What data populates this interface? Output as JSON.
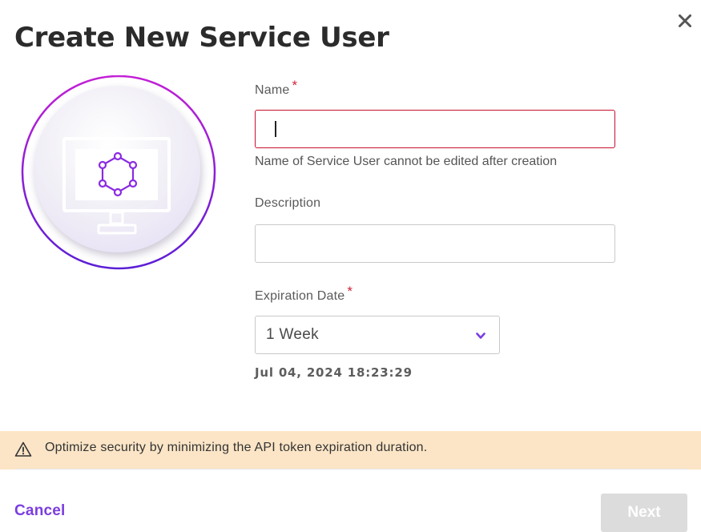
{
  "dialog": {
    "title": "Create New Service User",
    "close_icon": "close-icon"
  },
  "illustration": {
    "icon": "monitor-hexagon-network-icon",
    "ring_colors": [
      "#c21fd6",
      "#5b1fd6"
    ]
  },
  "form": {
    "name": {
      "label": "Name",
      "required_mark": "*",
      "value": "",
      "helper": "Name of Service User cannot be edited after creation",
      "state": "error"
    },
    "description": {
      "label": "Description",
      "value": ""
    },
    "expiration": {
      "label": "Expiration Date",
      "required_mark": "*",
      "selected": "1 Week",
      "date_readout": "Jul 04, 2024 18:23:29",
      "chevron_icon": "chevron-down-icon"
    }
  },
  "alert": {
    "icon": "warning-icon",
    "text": "Optimize security by minimizing the API token expiration duration."
  },
  "footer": {
    "cancel_label": "Cancel",
    "next_label": "Next",
    "next_enabled": false
  },
  "colors": {
    "accent": "#7b3ee0",
    "error": "#c8102e",
    "required": "#d1233b",
    "alert_bg": "#fbe5c6",
    "disabled_button": "#dcdcdc"
  }
}
